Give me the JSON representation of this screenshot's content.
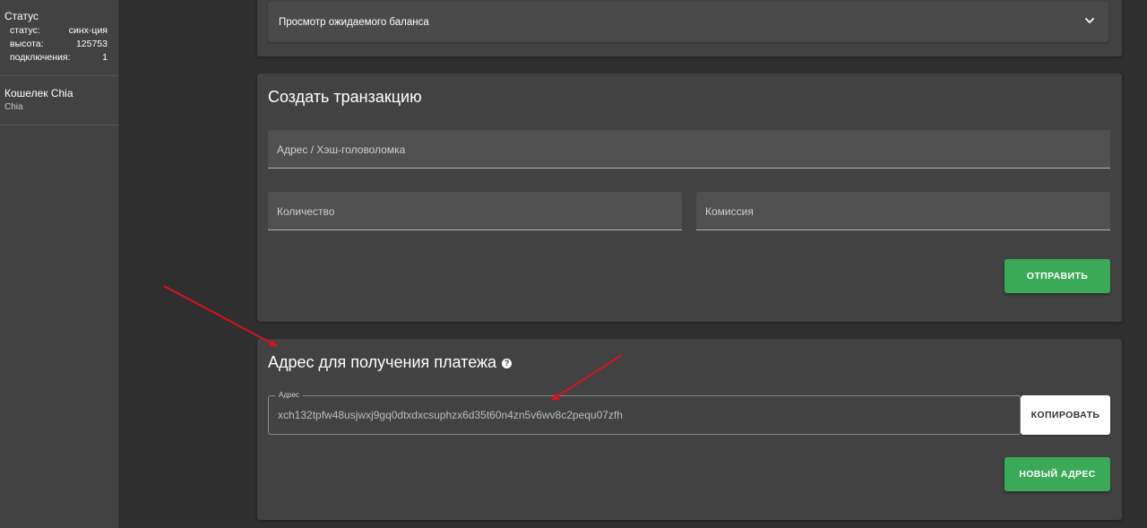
{
  "sidebar": {
    "status": {
      "title": "Статус",
      "rows": [
        {
          "label": "статус:",
          "value": "синх-ция"
        },
        {
          "label": "высота:",
          "value": "125753"
        },
        {
          "label": "подключения:",
          "value": "1"
        }
      ]
    },
    "wallet": {
      "title": "Кошелек Chia",
      "subtitle": "Chia"
    }
  },
  "balance_card": {
    "expander_label": "Просмотр ожидаемого баланса",
    "expander_icon": "chevron-down-icon"
  },
  "send_card": {
    "title": "Создать транзакцию",
    "address_placeholder": "Адрес / Хэш-головоломка",
    "amount_placeholder": "Количество",
    "fee_placeholder": "Комиссия",
    "send_label": "ОТПРАВИТЬ"
  },
  "receive_card": {
    "title": "Адрес для получения платежа",
    "help_icon": "help-circle-icon",
    "address_label": "Адрес",
    "address_value": "xch132tpfw48usjwxj9gq0dtxdxcsuphzx6d35t60n4zn5v6wv8c2pequ07zfh",
    "copy_label": "КОПИРОВАТЬ",
    "new_address_label": "НОВЫЙ АДРЕС"
  },
  "colors": {
    "accent_green": "#3aaa57",
    "annotation_red": "#d9141b",
    "card_bg": "#424242",
    "page_bg": "#2f2f2f"
  }
}
